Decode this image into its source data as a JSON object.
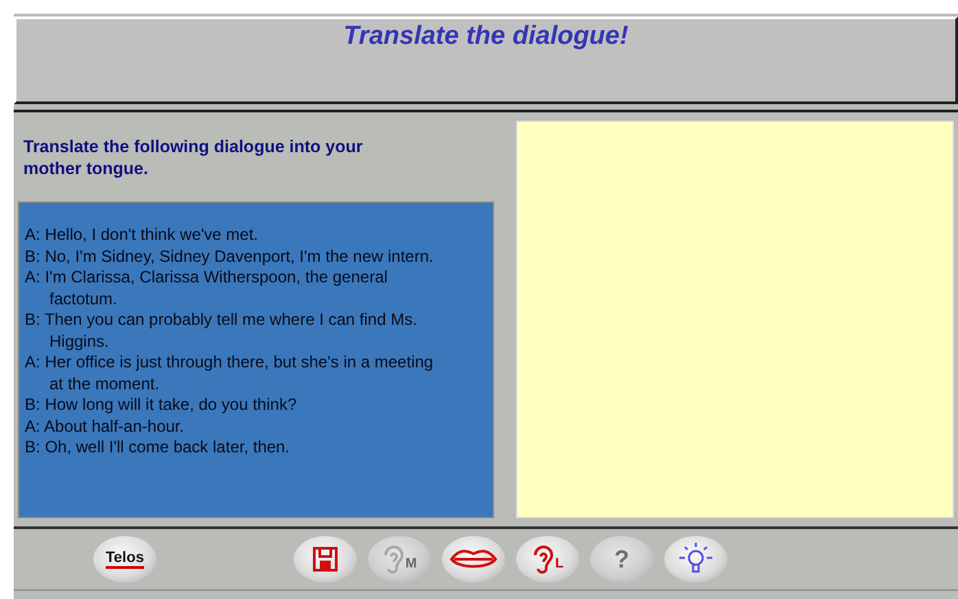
{
  "title": "Translate the dialogue!",
  "instruction": "Translate the following dialogue into your mother tongue.",
  "dialogue": [
    {
      "speaker": "A:",
      "text": "Hello, I don't think we've met."
    },
    {
      "speaker": "B:",
      "text": "No, I'm Sidney, Sidney Davenport, I'm the new intern."
    },
    {
      "speaker": "A:",
      "text": "I'm Clarissa, Clarissa Witherspoon, the general factotum."
    },
    {
      "speaker": "B:",
      "text": "Then you can probably tell me where I can find Ms. Higgins."
    },
    {
      "speaker": "A:",
      "text": "Her office is just through there, but she's in a meeting at the moment."
    },
    {
      "speaker": "B:",
      "text": "How long will it take, do you think?"
    },
    {
      "speaker": "A:",
      "text": "About half-an-hour."
    },
    {
      "speaker": "B:",
      "text": "Oh, well I'll come back later, then."
    }
  ],
  "toolbar": [
    {
      "kind": "logo",
      "label": "Telos",
      "disabled": false
    },
    {
      "kind": "save",
      "disabled": false
    },
    {
      "kind": "ear",
      "label": "M",
      "disabled": true
    },
    {
      "kind": "lips",
      "disabled": false
    },
    {
      "kind": "ear",
      "label": "L",
      "disabled": false
    },
    {
      "kind": "help",
      "label": "?",
      "disabled": true
    },
    {
      "kind": "bulb",
      "disabled": false
    }
  ]
}
